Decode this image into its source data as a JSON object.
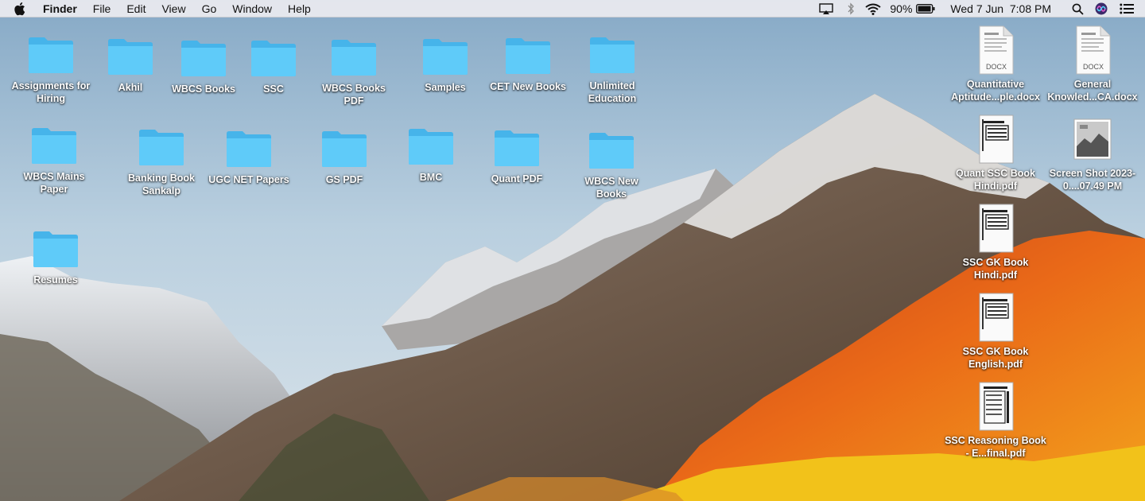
{
  "menubar": {
    "apple_icon": "apple-logo-icon",
    "app_name": "Finder",
    "items": [
      "File",
      "Edit",
      "View",
      "Go",
      "Window",
      "Help"
    ],
    "battery_percent": "90%",
    "datetime": "Wed 7 Jun  7:08 PM",
    "status_icons": [
      "airplay-icon",
      "bluetooth-icon",
      "wifi-icon",
      "battery-icon",
      "spotlight-search-icon",
      "siri-icon",
      "notification-center-icon"
    ]
  },
  "desktop": {
    "folders": [
      {
        "label": "Assignments for Hiring"
      },
      {
        "label": "Akhil"
      },
      {
        "label": "WBCS Books"
      },
      {
        "label": "SSC"
      },
      {
        "label": "WBCS Books PDF"
      },
      {
        "label": "Samples"
      },
      {
        "label": "CET New Books"
      },
      {
        "label": "Unlimited Education"
      },
      {
        "label": "WBCS Mains Paper"
      },
      {
        "label": "Banking Book Sankalp"
      },
      {
        "label": "UGC NET Papers"
      },
      {
        "label": "GS PDF"
      },
      {
        "label": "BMC"
      },
      {
        "label": "Quant PDF"
      },
      {
        "label": "WBCS New Books"
      },
      {
        "label": "Resumes"
      }
    ],
    "files": [
      {
        "label": "Quantitative Aptitude...ple.docx",
        "badge": "DOCX",
        "icon": "docx-file-icon"
      },
      {
        "label": "General Knowled...CA.docx",
        "badge": "DOCX",
        "icon": "docx-file-icon"
      },
      {
        "label": "Quant SSC Book Hindi.pdf",
        "icon": "pdf-file-icon"
      },
      {
        "label": "Screen Shot 2023-0....07.49 PM",
        "icon": "screenshot-image-icon"
      },
      {
        "label": "SSC GK Book Hindi.pdf",
        "icon": "pdf-file-icon"
      },
      {
        "label": "SSC GK Book English.pdf",
        "icon": "pdf-file-icon"
      },
      {
        "label": "SSC Reasoning Book - E...final.pdf",
        "icon": "pdf-file-icon"
      }
    ]
  },
  "colors": {
    "folder_blue": "#5cc8f8",
    "menubar_bg": "#ececf0",
    "label_text": "#ffffff"
  }
}
